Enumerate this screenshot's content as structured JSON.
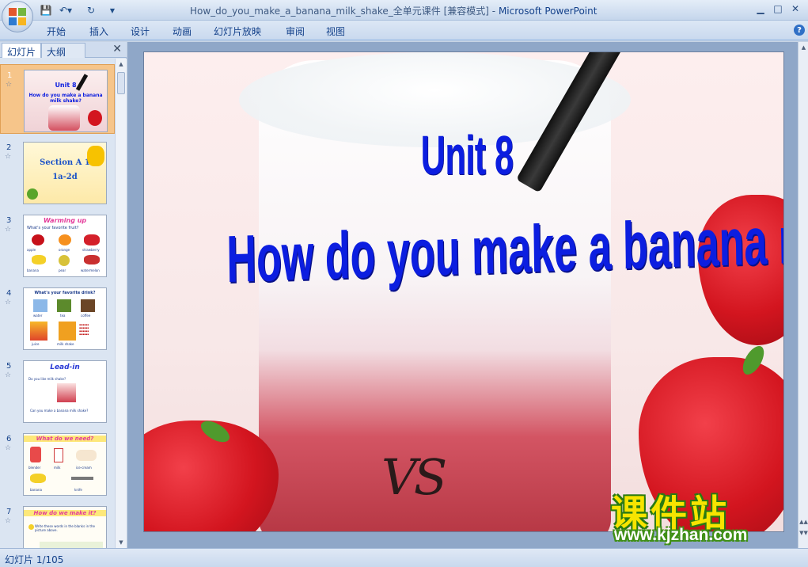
{
  "window": {
    "title": "How_do_you_make_a_banana_milk_shake_全单元课件 [兼容模式] - ",
    "app_name": "Microsoft PowerPoint",
    "minimize": "▁",
    "maximize": "□",
    "close": "✕"
  },
  "quick_access": {
    "save_icon": "save-icon",
    "undo_icon": "undo-icon",
    "redo_icon": "redo-icon",
    "customize_icon": "customize-icon",
    "save_glyph": "💾",
    "undo_glyph": "↶▾",
    "redo_glyph": "↻",
    "customize_glyph": "▼"
  },
  "ribbon": {
    "tabs": [
      "开始",
      "插入",
      "设计",
      "动画",
      "幻灯片放映",
      "审阅",
      "视图"
    ],
    "help": "?"
  },
  "left_pane": {
    "tab_slides": "幻灯片",
    "tab_outline": "大纲",
    "close": "✕",
    "thumbnails": [
      {
        "num": "1",
        "line1": "Unit 8",
        "line2": "How do you make a banana milk shake?"
      },
      {
        "num": "2",
        "line1": "Section A 1",
        "line2": "1a-2d"
      },
      {
        "num": "3",
        "line1": "Warming up",
        "line2": "What's your favorite fruit?",
        "labels": [
          "apple",
          "orange",
          "strawberry",
          "banana",
          "pear",
          "watermelon"
        ]
      },
      {
        "num": "4",
        "line1": "What's your favorite drink?",
        "line2": "",
        "labels": [
          "water",
          "tea",
          "coffee",
          "juice",
          "milk shake"
        ]
      },
      {
        "num": "5",
        "line1": "Lead-in",
        "line2": "Do you like milk shake?",
        "line3": "Can you make a banana milk shake?"
      },
      {
        "num": "6",
        "line1": "What do we need?",
        "line2": "",
        "labels": [
          "blender",
          "milk",
          "ice-cream",
          "banana",
          "knife"
        ]
      },
      {
        "num": "7",
        "line1": "How do we make it?",
        "line2": "Write these words in the blanks in the picture above."
      }
    ],
    "star": "☆"
  },
  "slide": {
    "title": "Unit 8",
    "subtitle": "How do you make a banana milk shake?",
    "cup_logo": "VS"
  },
  "watermark": {
    "cn": "课件站",
    "url": "www.kjzhan.com"
  },
  "status": {
    "text": "幻灯片 1/105"
  }
}
